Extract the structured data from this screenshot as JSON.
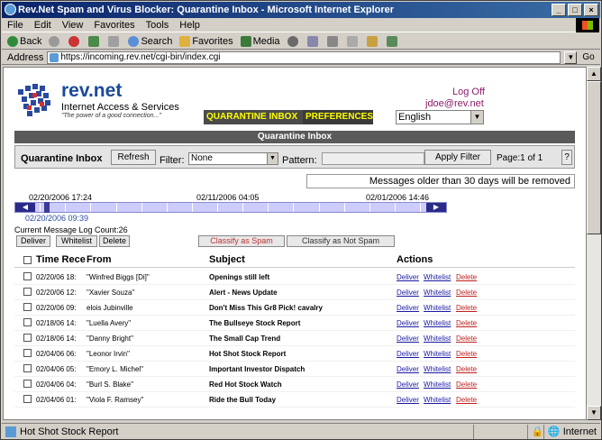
{
  "window": {
    "title": "Rev.Net Spam and Virus Blocker: Quarantine Inbox - Microsoft Internet Explorer",
    "controls": [
      "_",
      "□",
      "×"
    ]
  },
  "menu": [
    "File",
    "Edit",
    "View",
    "Favorites",
    "Tools",
    "Help"
  ],
  "toolbar": {
    "back": "Back",
    "search": "Search",
    "favorites": "Favorites",
    "media": "Media"
  },
  "address": {
    "label": "Address",
    "url": "https://incoming.rev.net/cgi-bin/index.cgi",
    "go": "Go"
  },
  "brand": {
    "name": "rev.net",
    "subtitle": "Internet Access & Services",
    "tagline": "\"The power of a good connection...\""
  },
  "user": {
    "logoff": "Log Off",
    "email": "jdoe@rev.net"
  },
  "tabs": {
    "quarantine": "QUARANTINE INBOX",
    "preferences": "PREFERENCES"
  },
  "language": "English",
  "section_title": "Quarantine Inbox",
  "filter": {
    "inbox_label": "Quarantine Inbox",
    "refresh": "Refresh",
    "filter_label": "Filter:",
    "filter_value": "None",
    "pattern_label": "Pattern:",
    "apply": "Apply Filter",
    "page": "Page:1 of 1",
    "help": "?"
  },
  "older_notice": "Messages older than 30 days will be removed",
  "timeline": {
    "dates": [
      "02/20/2006 17:24",
      "02/11/2006 04:05",
      "02/01/2006 14:46"
    ],
    "current": "02/20/2006 09:39"
  },
  "message_count": "Current Message Log Count:26",
  "actions": {
    "deliver": "Deliver",
    "whitelist": "Whitelist",
    "delete": "Delete",
    "classify_spam": "Classify as Spam",
    "classify_not_spam": "Classify as Not Spam"
  },
  "table": {
    "headers": {
      "time": "Time Rece",
      "from": "From",
      "subject": "Subject",
      "actions": "Actions"
    },
    "rows": [
      {
        "time": "02/20/06 18:",
        "from": "\"Winfred Biggs [Di]\"",
        "subject": "Openings still left"
      },
      {
        "time": "02/20/06 12:",
        "from": "\"Xavier Souza\"",
        "subject": "Alert - News Update"
      },
      {
        "time": "02/20/06 09:",
        "from": "elois Jubinville",
        "subject": "Don't Miss This Gr8 Pick! cavalry"
      },
      {
        "time": "02/18/06 14:",
        "from": "\"Luella Avery\"",
        "subject": "The Bullseye Stock Report"
      },
      {
        "time": "02/18/06 14:",
        "from": "\"Danny Bright\"",
        "subject": "The Small Cap Trend"
      },
      {
        "time": "02/04/06 06:",
        "from": "\"Leonor Irvin\"",
        "subject": "Hot Shot Stock Report"
      },
      {
        "time": "02/04/06 05:",
        "from": "\"Emory L. Michel\"",
        "subject": "Important Investor Dispatch"
      },
      {
        "time": "02/04/06 04:",
        "from": "\"Burl S. Blake\"",
        "subject": "Red Hot Stock Watch"
      },
      {
        "time": "02/04/06 01:",
        "from": "\"Viola F. Ramsey\"",
        "subject": "Ride the Bull Today"
      }
    ],
    "row_actions": [
      "Deliver",
      "Whitelist",
      "Delete"
    ]
  },
  "status": {
    "text": "Hot Shot Stock Report",
    "zone": "Internet"
  }
}
